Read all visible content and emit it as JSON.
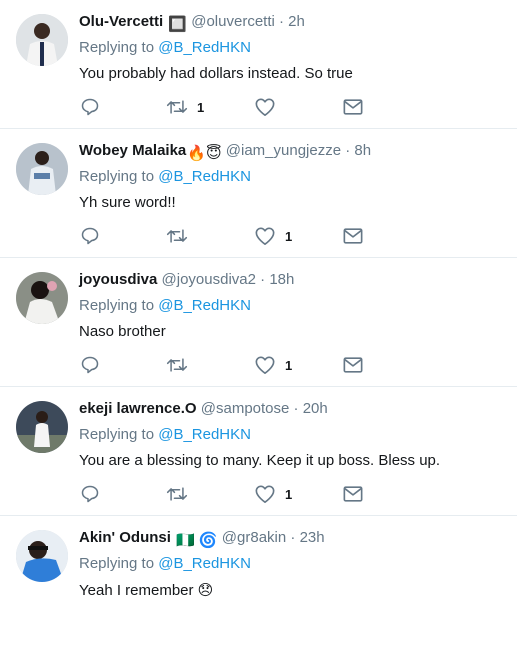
{
  "tweets": [
    {
      "name": "Olu-Vercetti",
      "name_suffix": "🔲",
      "handle": "@oluvercetti",
      "time": "2h",
      "replying_prefix": "Replying to",
      "replying_to": "@B_RedHKN",
      "text": "You probably had dollars instead. So true",
      "reply_count": "",
      "retweet_count": "1",
      "like_count": ""
    },
    {
      "name": "Wobey Malaika",
      "name_suffix": "🔥😇",
      "handle": "@iam_yungjezze",
      "time": "8h",
      "replying_prefix": "Replying to",
      "replying_to": "@B_RedHKN",
      "text": "Yh sure word!!",
      "reply_count": "",
      "retweet_count": "",
      "like_count": "1"
    },
    {
      "name": "joyousdiva",
      "name_suffix": "",
      "handle": "@joyousdiva2",
      "time": "18h",
      "replying_prefix": "Replying to",
      "replying_to": "@B_RedHKN",
      "text": "Naso brother",
      "reply_count": "",
      "retweet_count": "",
      "like_count": "1"
    },
    {
      "name": "ekeji lawrence.O",
      "name_suffix": "",
      "handle": "@sampotose",
      "time": "20h",
      "replying_prefix": "Replying to",
      "replying_to": "@B_RedHKN",
      "text": "You are a blessing to many. Keep it up boss. Bless up.",
      "reply_count": "",
      "retweet_count": "",
      "like_count": "1"
    },
    {
      "name": "Akin' Odunsi",
      "name_suffix": "🇳🇬 🌀",
      "handle": "@gr8akin",
      "time": "23h",
      "replying_prefix": "Replying to",
      "replying_to": "@B_RedHKN",
      "text": "Yeah I remember 😞",
      "reply_count": "",
      "retweet_count": "",
      "like_count": ""
    }
  ],
  "separator": "·",
  "icons": {
    "reply": "reply-icon",
    "retweet": "retweet-icon",
    "like": "heart-icon",
    "message": "direct-message-icon"
  },
  "colors": {
    "icon": "#657786",
    "mention": "#1b95e0",
    "divider": "#e6ecf0"
  }
}
